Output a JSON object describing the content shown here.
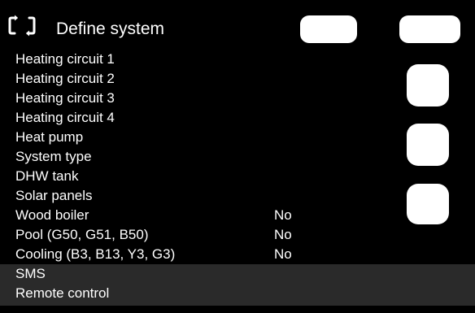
{
  "header": {
    "title": "Define system",
    "icon": "refresh-icon"
  },
  "menu": {
    "items": [
      {
        "label": "Heating circuit 1",
        "value": ""
      },
      {
        "label": "Heating circuit 2",
        "value": ""
      },
      {
        "label": "Heating circuit 3",
        "value": ""
      },
      {
        "label": "Heating circuit 4",
        "value": ""
      },
      {
        "label": "Heat pump",
        "value": ""
      },
      {
        "label": "System type",
        "value": ""
      },
      {
        "label": "DHW tank",
        "value": ""
      },
      {
        "label": "Solar panels",
        "value": ""
      },
      {
        "label": "Wood boiler",
        "value": "No"
      },
      {
        "label": "Pool (G50, G51, B50)",
        "value": "No"
      },
      {
        "label": "Cooling (B3, B13, Y3, G3)",
        "value": "No"
      },
      {
        "label": "SMS",
        "value": ""
      },
      {
        "label": "Remote control",
        "value": ""
      }
    ]
  },
  "colors": {
    "background": "#000000",
    "text": "#ffffff",
    "highlight_row": "#2a2a2a",
    "button": "#ffffff"
  }
}
